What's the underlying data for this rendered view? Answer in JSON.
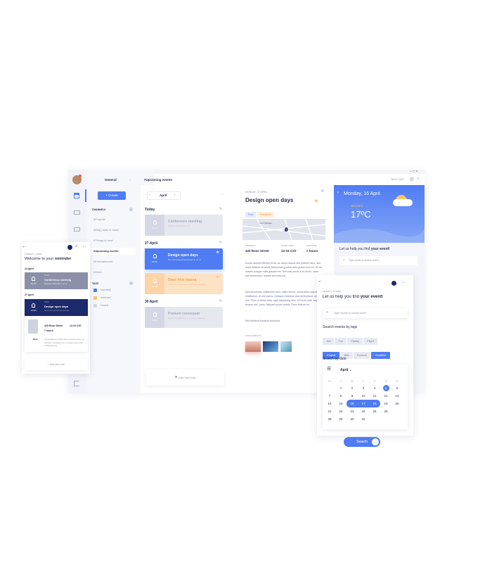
{
  "window": {
    "timezone": "16:07 CET",
    "controls": [
      "–",
      "□",
      "×"
    ]
  },
  "sidebar": {
    "workspace": "General",
    "create": "+ Create",
    "channels_header": "CHANNELS",
    "channels": [
      "#Projects",
      "#Blog posts to make",
      "#Things to read",
      "#Upcoming events",
      "#Entertainment",
      "#Work"
    ],
    "tags_header": "TAGS",
    "tags": [
      {
        "label": "Important",
        "color": "#4f7cf3"
      },
      {
        "label": "Irrelevant",
        "color": "#f7c56b"
      },
      {
        "label": "Default",
        "color": "#d4d8e6"
      }
    ]
  },
  "list": {
    "channel_title": "#Upcoming events",
    "month": "April",
    "groups": [
      {
        "day": "Today",
        "items": [
          {
            "title": "Conference meeting",
            "desc": "Aliquam bibendum ex ut",
            "time": "10:00",
            "style": "muted"
          }
        ]
      },
      {
        "day": "27 April",
        "items": [
          {
            "title": "Design open days",
            "desc": "Nec nisl suscipit accumsan in ex mi",
            "time": "10:00",
            "style": "active"
          },
          {
            "title": "Diam felis massa",
            "desc": "Vestibulum ante ipsum primis in faucibus",
            "time": "10:00",
            "style": "warm"
          }
        ]
      },
      {
        "day": "30 April",
        "items": [
          {
            "title": "Pretium consequat",
            "desc": "Nullam fringilla mi mi. Ut nisi ex aliquam",
            "time": "10:00",
            "style": "muted"
          }
        ]
      }
    ],
    "add_note": "Add new note"
  },
  "detail": {
    "date": "MONDAY, 27 APRIL",
    "title": "Design open days",
    "tags": [
      "Fun",
      "Freedom"
    ],
    "address_label": "ADDRESS",
    "address": "420 Rose Street",
    "start_label": "START TIME",
    "start": "12:15 CST",
    "duration_label": "DURATION",
    "duration": "7 hours",
    "map_label": "Lord Chicago",
    "body1": "Donec laoreet efficitur id hic, ac dilum mauris sed pretium arcu, dus misur tinidunt sit amet, Maecenas gravida ante gravid sed est. Ut vel mauris congue nulla gravida vel. Sed erat purus id et sit vel, dolor sed fermentum, mauris sed duis elit.",
    "body2": "Sed accumsan vestibulum arcu, ullam sed id, consectetur ipsum at vestibulum, et nisl varius. Quisque maximus duis at tincidunt, sed sed. Proin ut tellus nulla, eget adipiscing sem. Ut tortor ante, sagittis tempor nec, justo. Aliquam ipsum primis. Proin felis at vel.",
    "body3": "Sed eleifend tincidunt tincidunt.",
    "attachments_label": "ATTACHMENTS"
  },
  "weather": {
    "date": "Monday, 16 April",
    "location": "WEATHER",
    "temp": "17ºC",
    "help_prefix": "Let us help you find ",
    "help_bold": "your event!",
    "search_placeholder": "Type words to search event"
  },
  "reminder": {
    "date": "MONDAY, 1 APRIL",
    "title_prefix": "Welcome to your ",
    "title_bold": "reminder",
    "g1": "24 April",
    "g2": "27 April",
    "c1_tag": "Work",
    "c1_title": "Conference meeting",
    "c1_desc": "Aliquam bibendum ex ut",
    "c1_time": "10:00",
    "c2_tag": "Work",
    "c2_title": "Design open days",
    "c2_desc": "Nec nisl suscipit accumsan",
    "c2_time": "10:00",
    "addr": "420 Rose Street",
    "start": "12:15 CST",
    "duration": "7 hours",
    "note_label": "Note",
    "note": "Ut id eleifend ut nibh. Nunc eu vel sit amet. Ut elit tortor, volutpat et eu. Ut ipsum sed tortor, consequat sed.",
    "add": "+ Add new note"
  },
  "finder": {
    "date": "MONDAY, 16 APRIL",
    "title_prefix": "Let us help you find ",
    "title_bold": "your event!",
    "search_placeholder": "Type words to search event",
    "tags_title": "Search events by tags",
    "tags": [
      {
        "l": "Job",
        "on": false
      },
      {
        "l": "Fun",
        "on": false
      },
      {
        "l": "Family",
        "on": false
      },
      {
        "l": "Flight",
        "on": false
      },
      {
        "l": "Project",
        "on": true
      },
      {
        "l": "Bills",
        "on": false
      },
      {
        "l": "Festival",
        "on": false
      },
      {
        "l": "Headline",
        "on": true
      }
    ],
    "date_title": "Search by date",
    "month": "April ⌄",
    "weekdays": [
      "M",
      "T",
      "W",
      "T",
      "F",
      "S",
      "S"
    ],
    "weeks": [
      [
        "",
        "1",
        "2",
        "3",
        "4",
        "5",
        "6"
      ],
      [
        "7",
        "8",
        "9",
        "10",
        "11",
        "12",
        "13"
      ],
      [
        "14",
        "15",
        "16",
        "17",
        "18",
        "19",
        "20"
      ],
      [
        "21",
        "22",
        "23",
        "24",
        "25",
        "26",
        ""
      ],
      [
        "28",
        "29",
        "30",
        "31",
        "",
        "",
        ""
      ]
    ],
    "search": "Search"
  }
}
